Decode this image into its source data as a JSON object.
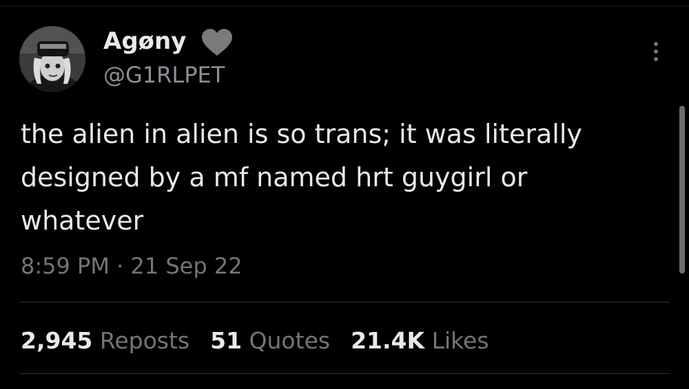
{
  "tweet": {
    "author": {
      "display_name": "Agøny",
      "handle": "@G1RLPET",
      "avatar_icon": "avatar-photo",
      "name_decoration_icon": "grey-heart-icon"
    },
    "text_lines": [
      "the alien in alien is so trans; it was literally",
      "designed by a mf named hrt guygirl or",
      "whatever"
    ],
    "timestamp": "8:59 PM · 21 Sep 22",
    "stats": {
      "reposts_count": "2,945",
      "reposts_label": "Reposts",
      "quotes_count": "51",
      "quotes_label": "Quotes",
      "likes_count": "21.4K",
      "likes_label": "Likes"
    }
  },
  "theme": {
    "background": "#000000",
    "primary_text": "#e7e9ea",
    "secondary_text": "#71767b",
    "divider": "#2f3336"
  }
}
